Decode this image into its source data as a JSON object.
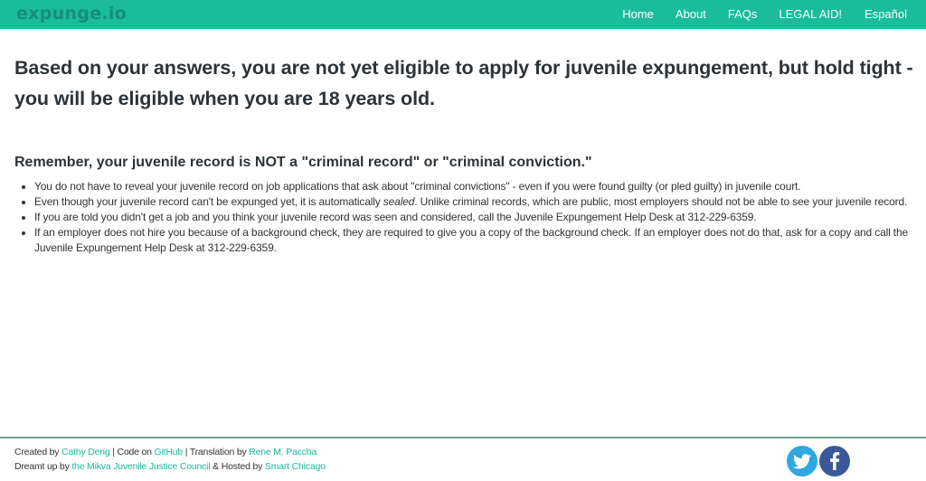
{
  "navbar": {
    "brand": "expunge.io",
    "links": [
      {
        "label": "Home"
      },
      {
        "label": "About"
      },
      {
        "label": "FAQs"
      },
      {
        "label": "LEGAL AID!"
      },
      {
        "label": "Español"
      }
    ],
    "colors": {
      "background": "#1abc9c",
      "brand": "#168e77",
      "link": "#ffffff"
    }
  },
  "main": {
    "heading": "Based on your answers, you are not yet eligible to apply for juvenile expungement, but hold tight - you will be eligible when you are 18 years old.",
    "subheading": "Remember, your juvenile record is NOT a \"criminal record\" or \"criminal conviction.\"",
    "bullets": [
      {
        "text": "You do not have to reveal your juvenile record on job applications that ask about \"criminal convictions\" - even if you were found guilty (or pled guilty) in juvenile court."
      },
      {
        "before": "Even though your juvenile record can't be expunged yet, it is automatically ",
        "emphasis": "sealed",
        "after": ". Unlike criminal records, which are public, most employers should not be able to see your juvenile record."
      },
      {
        "text": "If you are told you didn't get a job and you think your juvenile record was seen and considered, call the Juvenile Expungement Help Desk at 312-229-6359."
      },
      {
        "text": "If an employer does not hire you because of a background check, they are required to give you a copy of the background check. If an employer does not do that, ask for a copy and call the Juvenile Expungement Help Desk at 312-229-6359."
      }
    ]
  },
  "footer": {
    "line1": {
      "created_by": "Created by ",
      "creator_link": "Cathy Deng",
      "code_on": " | Code on ",
      "github_link": "GitHub",
      "translation_by": " | Translation by ",
      "translator_link": "Rene M. Paccha"
    },
    "line2": {
      "dreamt_up_by": "Dreamt up by ",
      "mikva_link": "the Mikva Juvenile Justice Council",
      "hosted_by": " & Hosted by ",
      "host_link": "Smart Chicago"
    },
    "social": [
      {
        "name": "twitter-icon",
        "color": "#2fa7e0"
      },
      {
        "name": "facebook-icon",
        "color": "#3b5998"
      }
    ],
    "link_color": "#1abc9c"
  }
}
